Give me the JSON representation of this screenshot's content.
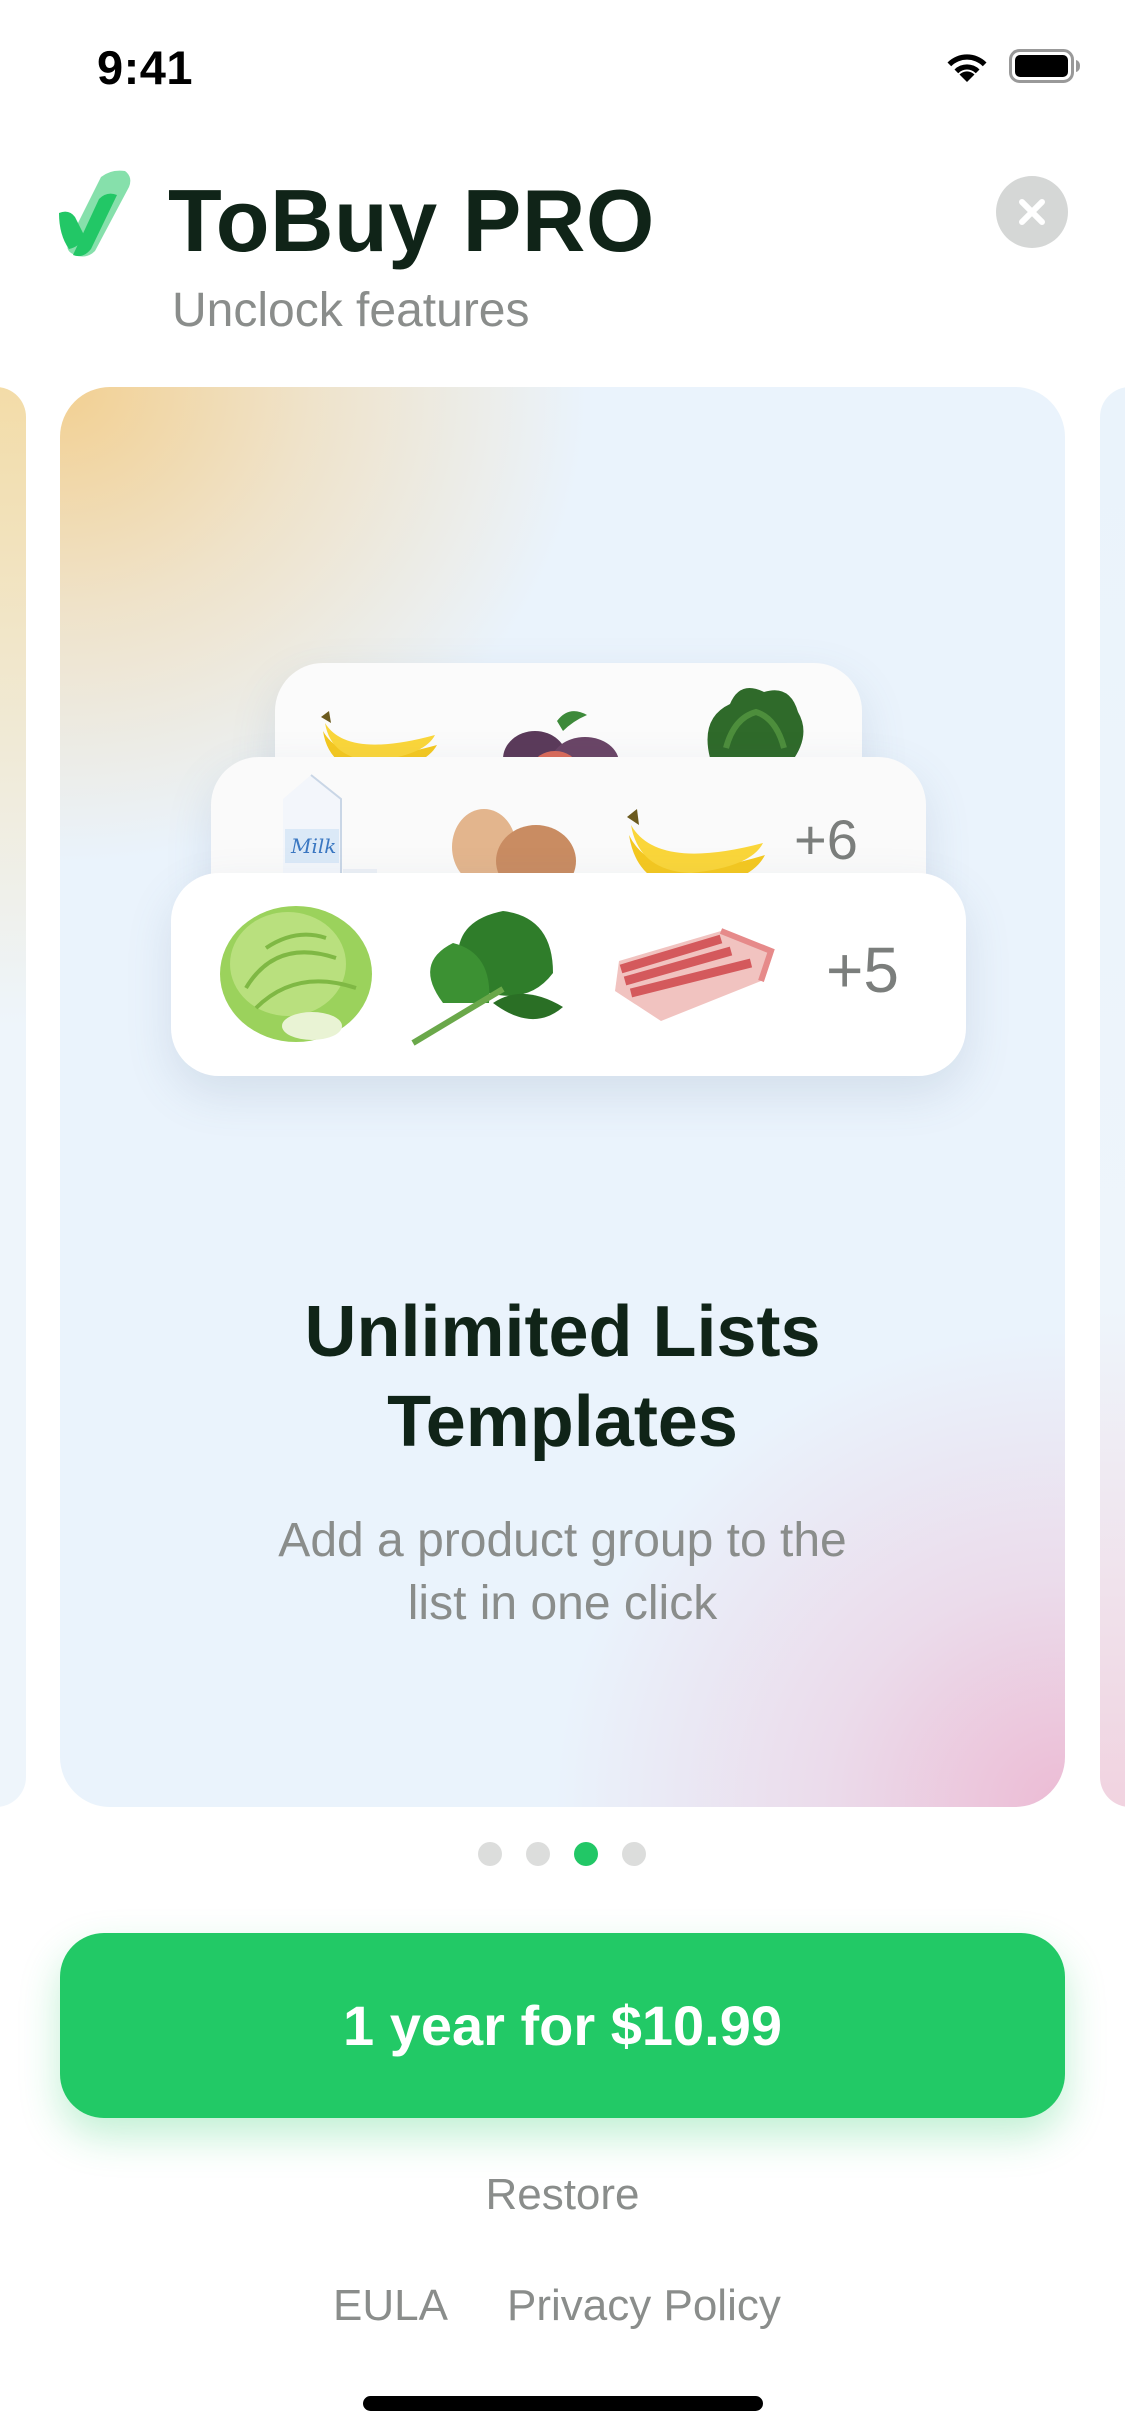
{
  "status_bar": {
    "time": "9:41",
    "wifi_icon": "wifi-icon",
    "battery_icon": "battery-icon"
  },
  "header": {
    "title": "ToBuy PRO",
    "subtitle": "Unclock features",
    "close_icon": "close-icon",
    "logo_icon": "checkmark-logo-icon",
    "brand_color": "#22C766"
  },
  "carousel": {
    "active_index": 2,
    "page_count": 4,
    "feature": {
      "title_line1": "Unlimited Lists",
      "title_line2": "Templates",
      "description_line1": "Add a product group to the",
      "description_line2": "list in one click"
    },
    "template_cards": [
      {
        "items": [
          "banana",
          "figs",
          "kale"
        ],
        "more": ""
      },
      {
        "items": [
          "milk",
          "eggs",
          "banana"
        ],
        "more": "+6"
      },
      {
        "items": [
          "lettuce",
          "spinach",
          "pork-belly"
        ],
        "more": "+5"
      }
    ]
  },
  "purchase": {
    "cta_label": "1 year for $10.99",
    "restore_label": "Restore"
  },
  "footer": {
    "eula_label": "EULA",
    "privacy_label": "Privacy Policy"
  }
}
